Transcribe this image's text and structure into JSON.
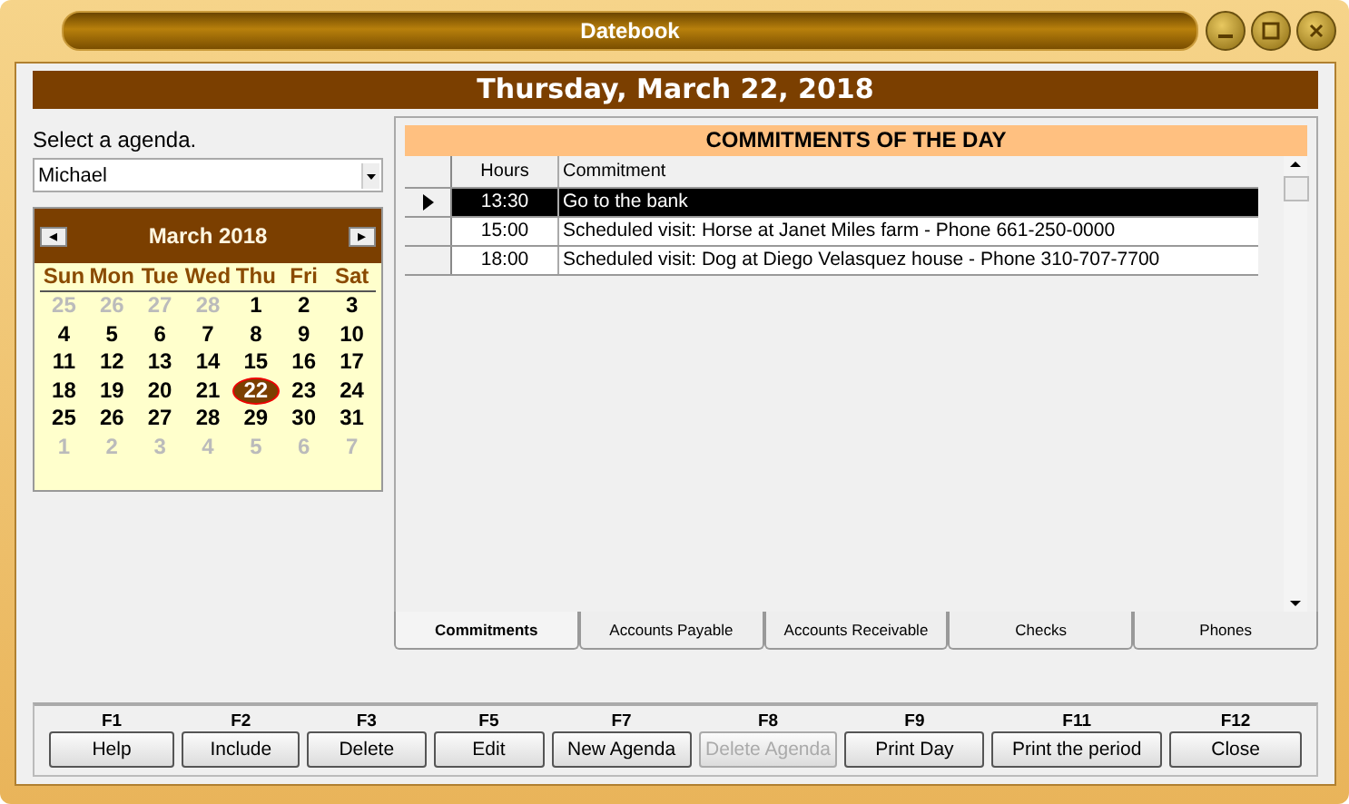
{
  "window": {
    "title": "Datebook"
  },
  "date_header": "Thursday, March 22, 2018",
  "agenda": {
    "label": "Select a agenda.",
    "value": "Michael"
  },
  "calendar": {
    "prev": "◂",
    "next": "▸",
    "month": "March 2018",
    "weekdays": [
      "Sun",
      "Mon",
      "Tue",
      "Wed",
      "Thu",
      "Fri",
      "Sat"
    ],
    "days": [
      {
        "day": "25",
        "in_month": false,
        "selected": false
      },
      {
        "day": "26",
        "in_month": false,
        "selected": false
      },
      {
        "day": "27",
        "in_month": false,
        "selected": false
      },
      {
        "day": "28",
        "in_month": false,
        "selected": false
      },
      {
        "day": "1",
        "in_month": true,
        "selected": false
      },
      {
        "day": "2",
        "in_month": true,
        "selected": false
      },
      {
        "day": "3",
        "in_month": true,
        "selected": false
      },
      {
        "day": "4",
        "in_month": true,
        "selected": false
      },
      {
        "day": "5",
        "in_month": true,
        "selected": false
      },
      {
        "day": "6",
        "in_month": true,
        "selected": false
      },
      {
        "day": "7",
        "in_month": true,
        "selected": false
      },
      {
        "day": "8",
        "in_month": true,
        "selected": false
      },
      {
        "day": "9",
        "in_month": true,
        "selected": false
      },
      {
        "day": "10",
        "in_month": true,
        "selected": false
      },
      {
        "day": "11",
        "in_month": true,
        "selected": false
      },
      {
        "day": "12",
        "in_month": true,
        "selected": false
      },
      {
        "day": "13",
        "in_month": true,
        "selected": false
      },
      {
        "day": "14",
        "in_month": true,
        "selected": false
      },
      {
        "day": "15",
        "in_month": true,
        "selected": false
      },
      {
        "day": "16",
        "in_month": true,
        "selected": false
      },
      {
        "day": "17",
        "in_month": true,
        "selected": false
      },
      {
        "day": "18",
        "in_month": true,
        "selected": false
      },
      {
        "day": "19",
        "in_month": true,
        "selected": false
      },
      {
        "day": "20",
        "in_month": true,
        "selected": false
      },
      {
        "day": "21",
        "in_month": true,
        "selected": false
      },
      {
        "day": "22",
        "in_month": true,
        "selected": true
      },
      {
        "day": "23",
        "in_month": true,
        "selected": false
      },
      {
        "day": "24",
        "in_month": true,
        "selected": false
      },
      {
        "day": "25",
        "in_month": true,
        "selected": false
      },
      {
        "day": "26",
        "in_month": true,
        "selected": false
      },
      {
        "day": "27",
        "in_month": true,
        "selected": false
      },
      {
        "day": "28",
        "in_month": true,
        "selected": false
      },
      {
        "day": "29",
        "in_month": true,
        "selected": false
      },
      {
        "day": "30",
        "in_month": true,
        "selected": false
      },
      {
        "day": "31",
        "in_month": true,
        "selected": false
      },
      {
        "day": "1",
        "in_month": false,
        "selected": false
      },
      {
        "day": "2",
        "in_month": false,
        "selected": false
      },
      {
        "day": "3",
        "in_month": false,
        "selected": false
      },
      {
        "day": "4",
        "in_month": false,
        "selected": false
      },
      {
        "day": "5",
        "in_month": false,
        "selected": false
      },
      {
        "day": "6",
        "in_month": false,
        "selected": false
      },
      {
        "day": "7",
        "in_month": false,
        "selected": false
      }
    ]
  },
  "commitments": {
    "title": "COMMITMENTS OF THE DAY",
    "columns": [
      "Hours",
      "Commitment"
    ],
    "rows": [
      {
        "hours": "13:30",
        "commitment": "Go to the bank",
        "selected": true
      },
      {
        "hours": "15:00",
        "commitment": "Scheduled visit: Horse at Janet Miles farm - Phone 661-250-0000",
        "selected": false
      },
      {
        "hours": "18:00",
        "commitment": "Scheduled visit: Dog at Diego Velasquez house - Phone 310-707-7700",
        "selected": false
      }
    ]
  },
  "tabs": [
    {
      "label": "Commitments",
      "selected": true
    },
    {
      "label": "Accounts Payable",
      "selected": false
    },
    {
      "label": "Accounts Receivable",
      "selected": false
    },
    {
      "label": "Checks",
      "selected": false
    },
    {
      "label": "Phones",
      "selected": false
    }
  ],
  "buttons": [
    {
      "key": "F1",
      "label": "Help",
      "disabled": false
    },
    {
      "key": "F2",
      "label": "Include",
      "disabled": false
    },
    {
      "key": "F3",
      "label": "Delete",
      "disabled": false
    },
    {
      "key": "F5",
      "label": "Edit",
      "disabled": false
    },
    {
      "key": "F7",
      "label": "New Agenda",
      "disabled": false
    },
    {
      "key": "F8",
      "label": "Delete Agenda",
      "disabled": true
    },
    {
      "key": "F9",
      "label": "Print Day",
      "disabled": false
    },
    {
      "key": "F11",
      "label": "Print the period",
      "disabled": false
    },
    {
      "key": "F12",
      "label": "Close",
      "disabled": false
    }
  ]
}
